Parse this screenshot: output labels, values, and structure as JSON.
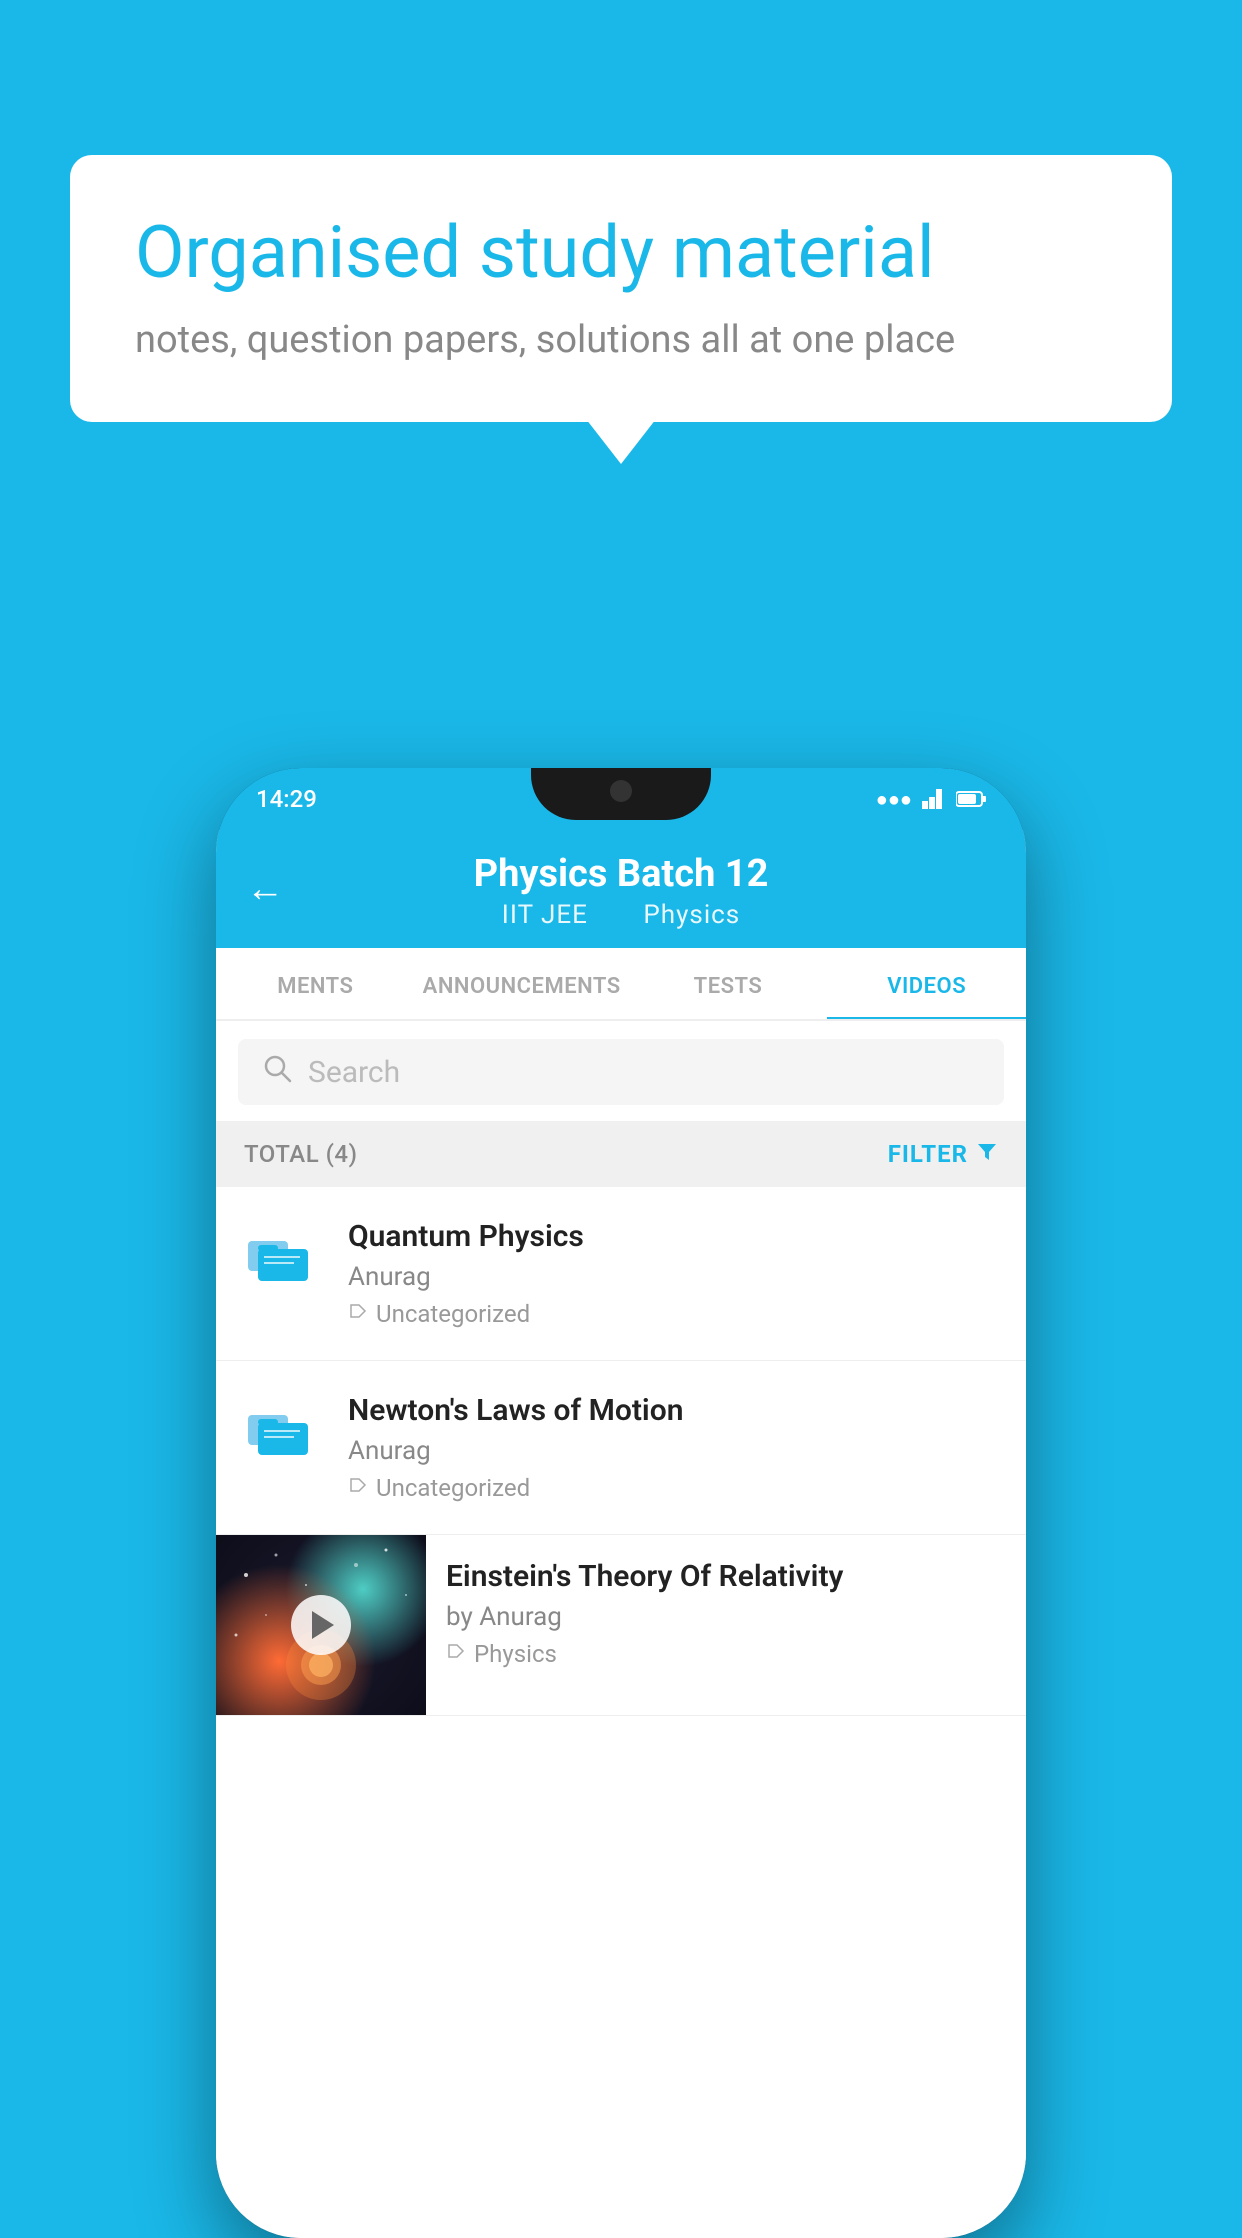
{
  "background": {
    "color": "#1ab8e8"
  },
  "speech_bubble": {
    "title": "Organised study material",
    "subtitle": "notes, question papers, solutions all at one place"
  },
  "phone": {
    "status_bar": {
      "time": "14:29"
    },
    "header": {
      "title": "Physics Batch 12",
      "subtitle_part1": "IIT JEE",
      "subtitle_part2": "Physics",
      "back_label": "←"
    },
    "tabs": [
      {
        "label": "MENTS",
        "active": false
      },
      {
        "label": "ANNOUNCEMENTS",
        "active": false
      },
      {
        "label": "TESTS",
        "active": false
      },
      {
        "label": "VIDEOS",
        "active": true
      }
    ],
    "search": {
      "placeholder": "Search"
    },
    "filter_bar": {
      "total_label": "TOTAL (4)",
      "filter_label": "FILTER"
    },
    "videos": [
      {
        "type": "folder",
        "title": "Quantum Physics",
        "author": "Anurag",
        "tag": "Uncategorized",
        "has_thumbnail": false
      },
      {
        "type": "folder",
        "title": "Newton's Laws of Motion",
        "author": "Anurag",
        "tag": "Uncategorized",
        "has_thumbnail": false
      },
      {
        "type": "video",
        "title": "Einstein's Theory Of Relativity",
        "author": "by Anurag",
        "tag": "Physics",
        "has_thumbnail": true
      }
    ]
  }
}
